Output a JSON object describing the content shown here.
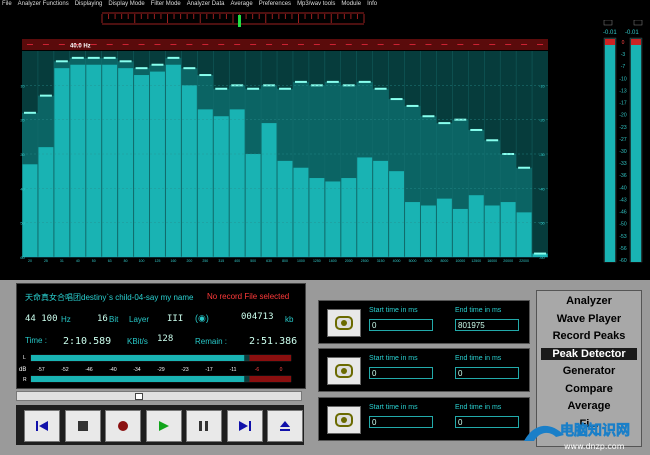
{
  "menu_bar": [
    "File",
    "Analyzer Functions",
    "Displaying",
    "Display Mode",
    "Filter Mode",
    "Analyzer Data",
    "Average",
    "Preferences",
    "Mp3/wav tools",
    "Module",
    "Info"
  ],
  "spectrum": {
    "marker_label": "40.0 Hz",
    "y_ticks": [
      "-10",
      "-20",
      "-30",
      "-40",
      "-50",
      "-60"
    ],
    "freq_labels": [
      "20",
      "25",
      "31",
      "40",
      "50",
      "63",
      "80",
      "100",
      "125",
      "160",
      "200",
      "250",
      "315",
      "400",
      "500",
      "630",
      "800",
      "1000",
      "1250",
      "1600",
      "2000",
      "2500",
      "3150",
      "4000",
      "5000",
      "6300",
      "8000",
      "10000",
      "12500",
      "16000",
      "20000",
      "22000"
    ],
    "levels_db": [
      -33,
      -28,
      -5,
      -4,
      -4,
      -4,
      -5,
      -7,
      -6,
      -4,
      -10,
      -17,
      -19,
      -17,
      -30,
      -21,
      -32,
      -34,
      -37,
      -38,
      -37,
      -31,
      -32,
      -35,
      -44,
      -45,
      -43,
      -46,
      -42,
      -45,
      -44,
      -47,
      -59
    ],
    "peaks_db": [
      -18,
      -13,
      -3,
      -2,
      -2,
      -2,
      -3,
      -5,
      -4,
      -2,
      -5,
      -7,
      -11,
      -10,
      -11,
      -10,
      -11,
      -9,
      -10,
      -9,
      -10,
      -9,
      -11,
      -14,
      -16,
      -19,
      -21,
      -20,
      -23,
      -26,
      -30,
      -34,
      -59
    ],
    "accent_color": "#0a7f7f",
    "bar_color": "#19b3b3",
    "header_color": "#5a0b0b"
  },
  "vu": {
    "left_reading": "-0.01",
    "right_reading": "-0.01",
    "scale": [
      "0",
      "-3",
      "-7",
      "-10",
      "-13",
      "-17",
      "-20",
      "-23",
      "-27",
      "-30",
      "-33",
      "-36",
      "-40",
      "-43",
      "-46",
      "-50",
      "-53",
      "-56",
      "-60"
    ],
    "level_fraction": 0.99
  },
  "info": {
    "title": "天命真女合唱团destiny`s child-04-say my name",
    "record_status": "No record File selected",
    "sample_rate_value": "44 100",
    "sample_rate_unit": "Hz",
    "bits_value": "16",
    "bits_unit": "Bit",
    "layer_label": "Layer",
    "layer_value": "III",
    "stereo_symbol": "(◉)",
    "size_value": "004713",
    "size_unit": "kb",
    "time_label": "Time :",
    "time_value": "2:10.589",
    "bitrate_label": "KBit/s",
    "bitrate_value": "128",
    "remain_label": "Remain :",
    "remain_value": "2:51.386",
    "meter_scale": [
      "-57",
      "-52",
      "-46",
      "-40",
      "-34",
      "-29",
      "-23",
      "-17",
      "-11",
      "-6",
      "0"
    ],
    "meter_l_label": "L",
    "meter_r_label": "R",
    "meter_db_label": "dB",
    "meter_level_fraction": 0.82
  },
  "seek": {
    "position_fraction": 0.42
  },
  "transport": {
    "buttons": [
      "skip-back",
      "stop",
      "record",
      "play",
      "pause",
      "skip-forward",
      "eject"
    ]
  },
  "time_groups": [
    {
      "start_label": "Start time in ms",
      "start_value": "0",
      "end_label": "End time in ms",
      "end_value": "801975"
    },
    {
      "start_label": "Start time in ms",
      "start_value": "0",
      "end_label": "End time in ms",
      "end_value": "0"
    },
    {
      "start_label": "Start time in ms",
      "start_value": "0",
      "end_label": "End time in ms",
      "end_value": "0"
    }
  ],
  "mode_menu": [
    "Analyzer",
    "Wave Player",
    "Record Peaks",
    "Peak Detector",
    "Generator",
    "Compare",
    "Average",
    "Fi..."
  ],
  "mode_selected_index": 3,
  "watermark": {
    "line1": "电脑知识网",
    "line2": "www.dnzp.com"
  }
}
